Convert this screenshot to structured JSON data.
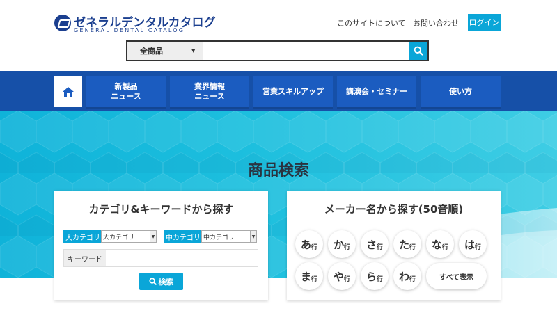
{
  "logo": {
    "jp": "ゼネラルデンタルカタログ",
    "en": "GENERAL DENTAL CATALOG"
  },
  "utility": {
    "about": "このサイトについて",
    "contact": "お問い合わせ",
    "login": "ログイン"
  },
  "search": {
    "scope": "全商品",
    "placeholder": ""
  },
  "nav": {
    "home_icon": "home-icon",
    "items": [
      {
        "label": "新製品\nニュース"
      },
      {
        "label": "業界情報\nニュース"
      },
      {
        "label": "営業スキルアップ"
      },
      {
        "label": "講演会・セミナー"
      },
      {
        "label": "使い方"
      }
    ]
  },
  "hero": {
    "title": "商品検索"
  },
  "category_panel": {
    "title": "カテゴリ&キーワードから探す",
    "major_label": "大カテゴリ",
    "major_value": "大カテゴリ",
    "middle_label": "中カテゴリ",
    "middle_value": "中カテゴリ",
    "keyword_label": "キーワード",
    "keyword_value": "",
    "search_button": "検索"
  },
  "maker_panel": {
    "title": "メーカー名から探す(50音順)",
    "rows": [
      [
        {
          "k": "あ",
          "s": "行"
        },
        {
          "k": "か",
          "s": "行"
        },
        {
          "k": "さ",
          "s": "行"
        },
        {
          "k": "た",
          "s": "行"
        },
        {
          "k": "な",
          "s": "行"
        },
        {
          "k": "は",
          "s": "行"
        }
      ],
      [
        {
          "k": "ま",
          "s": "行"
        },
        {
          "k": "や",
          "s": "行"
        },
        {
          "k": "ら",
          "s": "行"
        },
        {
          "k": "わ",
          "s": "行"
        }
      ]
    ],
    "show_all": "すべて表示"
  },
  "colors": {
    "brand": "#1b3f8f",
    "nav": "#1650a8",
    "accent": "#0aa6d8"
  }
}
